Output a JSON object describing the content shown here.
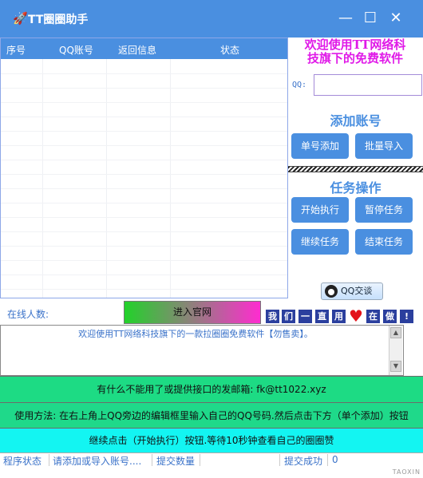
{
  "window": {
    "title": "TT圈圈助手",
    "min_glyph": "—",
    "max_glyph": "☐",
    "close_glyph": "✕"
  },
  "grid": {
    "columns": [
      "序号",
      "QQ账号",
      "返回信息",
      "状态"
    ]
  },
  "panel": {
    "welcome_line1": "欢迎使用TT网络科",
    "welcome_line2": "技旗下的免费软件",
    "qq_label": "QQ:",
    "qq_value": "",
    "add_title": "添加账号",
    "single_add": "单号添加",
    "batch_import": "批量导入",
    "task_title": "任务操作",
    "start": "开始执行",
    "pause": "暂停任务",
    "resume": "继续任务",
    "end": "结束任务",
    "qq_chat": "QQ交谈"
  },
  "online": {
    "label": "在线人数:",
    "enter_button": "进入官网"
  },
  "slogan": [
    "我",
    "们",
    "一",
    "直",
    "用",
    "在",
    "做",
    "!"
  ],
  "message": "欢迎使用TT网络科技旗下的一款拉圈圈免费软件【勿售卖】。",
  "info": {
    "line1": "有什么不能用了或提供接口的发邮箱: fk@tt1022.xyz",
    "line2": "使用方法: 在右上角上QQ旁边的编辑框里输入自己的QQ号码.然后点击下方（单个添加）按钮",
    "line3": "继续点击（开始执行）按钮.等待10秒钟查看自己的圈圈赞"
  },
  "statusbar": {
    "program_status": "程序状态",
    "hint": "请添加或导入账号....",
    "submit_count": "提交数量",
    "submit_success": "提交成功",
    "value": "0",
    "brand": "TAOXIN"
  },
  "colors": {
    "accent": "#4a8fe0",
    "welcome": "#e01ae8",
    "green_band": "#1ddb84",
    "cyan_band": "#13f5f2"
  }
}
